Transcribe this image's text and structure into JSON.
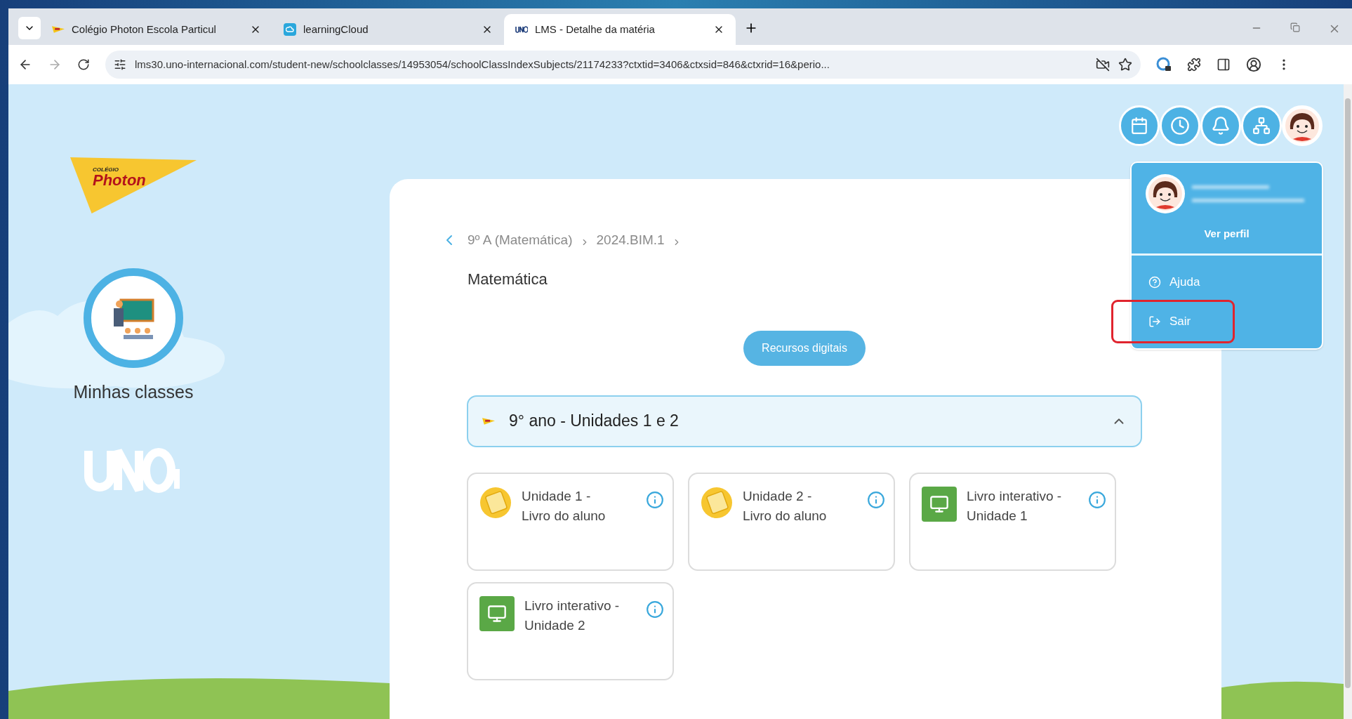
{
  "browser": {
    "tabs": [
      {
        "title": "Colégio Photon Escola Particul",
        "kind": "flag",
        "selected": false
      },
      {
        "title": "learningCloud",
        "kind": "cloud",
        "selected": false
      },
      {
        "title": "LMS - Detalhe da matéria",
        "kind": "uno",
        "selected": true
      }
    ],
    "url": "lms30.uno-internacional.com/student-new/schoolclasses/14953054/schoolClassIndexSubjects/21174233?ctxtid=3406&ctxsid=846&ctxrid=16&perio..."
  },
  "logo": {
    "small": "COLÉGIO",
    "name": "Photon"
  },
  "sidebar": {
    "items": [
      {
        "label": "Minhas classes",
        "selected": true
      }
    ]
  },
  "header_icons": [
    {
      "kind": "calendar"
    },
    {
      "kind": "clock"
    },
    {
      "kind": "bell"
    },
    {
      "kind": "sitemap"
    },
    {
      "kind": "avatar"
    }
  ],
  "profile_menu": {
    "link": "Ver perfil",
    "items": [
      {
        "label": "Ajuda",
        "kind": "help",
        "highlighted": false
      },
      {
        "label": "Sair",
        "kind": "logout",
        "highlighted": true
      }
    ]
  },
  "breadcrumb": [
    "9º A (Matemática)",
    "2024.BIM.1"
  ],
  "title": "Matemática",
  "resources_button": "Recursos digitais",
  "section": {
    "title": "9° ano - Unidades 1 e 2",
    "expanded": true,
    "cards": [
      {
        "kind": "book",
        "line1": "Unidade 1 -",
        "line2": "Livro do aluno"
      },
      {
        "kind": "book",
        "line1": "Unidade 2 -",
        "line2": "Livro do aluno"
      },
      {
        "kind": "interactive",
        "line1": "Livro interativo -",
        "line2": "Unidade 1"
      },
      {
        "kind": "interactive",
        "line1": "Livro interativo -",
        "line2": "Unidade 2"
      }
    ]
  }
}
